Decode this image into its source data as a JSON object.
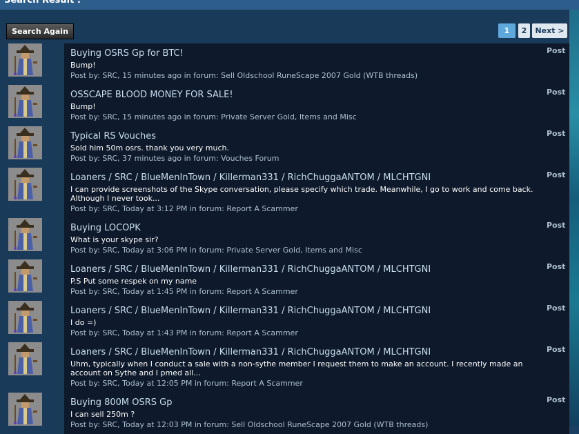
{
  "header": {
    "title": "Search Result :"
  },
  "toolbar": {
    "search_again_label": "Search Again"
  },
  "pagination": {
    "current": "1",
    "page2": "2",
    "next_label": "Next >"
  },
  "results": [
    {
      "title": "Buying OSRS Gp for BTC!",
      "snippet": "Bump!",
      "meta": "Post by: SRC, 15 minutes ago in forum: Sell Oldschool RuneScape 2007 Gold (WTB threads)",
      "tag": "Post"
    },
    {
      "title": "OSSCAPE BLOOD MONEY FOR SALE!",
      "snippet": "Bump!",
      "meta": "Post by: SRC, 15 minutes ago in forum: Private Server Gold, Items and Misc",
      "tag": "Post"
    },
    {
      "title": "Typical RS Vouches",
      "snippet": "Sold him 50m osrs. thank you very much.",
      "meta": "Post by: SRC, 37 minutes ago in forum: Vouches Forum",
      "tag": "Post"
    },
    {
      "title": "Loaners / SRC / BlueMenInTown / Killerman331 / RichChuggaANTOM / MLCHTGNI",
      "snippet": "I can provide screenshots of the Skype conversation, please specify which trade. Meanwhile, I go to work and come back. Although I never took...",
      "meta": "Post by: SRC, Today at 3:12 PM in forum: Report A Scammer",
      "tag": "Post"
    },
    {
      "title": "Buying LOCOPK",
      "snippet": "What is your skype sir?",
      "meta": "Post by: SRC, Today at 3:06 PM in forum: Private Server Gold, Items and Misc",
      "tag": "Post"
    },
    {
      "title": "Loaners / SRC / BlueMenInTown / Killerman331 / RichChuggaANTOM / MLCHTGNI",
      "snippet": "P.S Put some respek on my name",
      "meta": "Post by: SRC, Today at 1:45 PM in forum: Report A Scammer",
      "tag": "Post"
    },
    {
      "title": "Loaners / SRC / BlueMenInTown / Killerman331 / RichChuggaANTOM / MLCHTGNI",
      "snippet": "I do =)",
      "meta": "Post by: SRC, Today at 1:43 PM in forum: Report A Scammer",
      "tag": "Post"
    },
    {
      "title": "Loaners / SRC / BlueMenInTown / Killerman331 / RichChuggaANTOM / MLCHTGNI",
      "snippet": "Uhm, typically when I conduct a sale with a non-sythe member I request them to make an account. I recently made an account on Sythe and I pmed all...",
      "meta": "Post by: SRC, Today at 12:05 PM in forum: Report A Scammer",
      "tag": "Post"
    },
    {
      "title": "Buying 800M OSRS Gp",
      "snippet": "I can sell 250m ?",
      "meta": "Post by: SRC, Today at 12:03 PM in forum: Sell Oldschool RuneScape 2007 Gold (WTB threads)",
      "tag": "Post"
    }
  ]
}
